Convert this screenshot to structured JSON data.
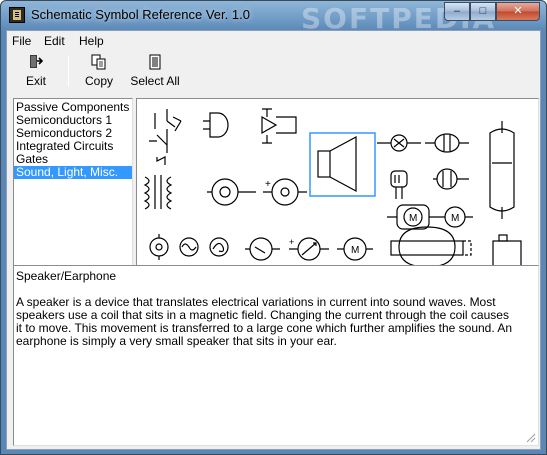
{
  "window": {
    "title": "Schematic Symbol Reference Ver. 1.0",
    "watermark": "SOFTPEDIA",
    "buttons": {
      "minimize": "–",
      "maximize": "□",
      "close": "✕"
    }
  },
  "menu": {
    "file": "File",
    "edit": "Edit",
    "help": "Help"
  },
  "toolbar": {
    "exit": "Exit",
    "copy": "Copy",
    "select_all": "Select All"
  },
  "categories": [
    "Passive Components",
    "Semiconductors 1",
    "Semiconductors 2",
    "Integrated Circuits",
    "Gates",
    "Sound, Light, Misc."
  ],
  "selected_category": "Sound, Light, Misc.",
  "symbol_labels": {
    "motor": "M",
    "plus": "+"
  },
  "description": {
    "title": "Speaker/Earphone",
    "body": "A speaker is a device that translates electrical variations in current into sound waves. Most speakers use a coil that sits in a magnetic field. Changing the current through the coil causes it to move. This movement is transferred to a large cone which further amplifies the sound. An earphone is simply a very small speaker that sits in your ear."
  },
  "colors": {
    "selection": "#3399ff",
    "symbol_highlight": "#3399ff"
  }
}
